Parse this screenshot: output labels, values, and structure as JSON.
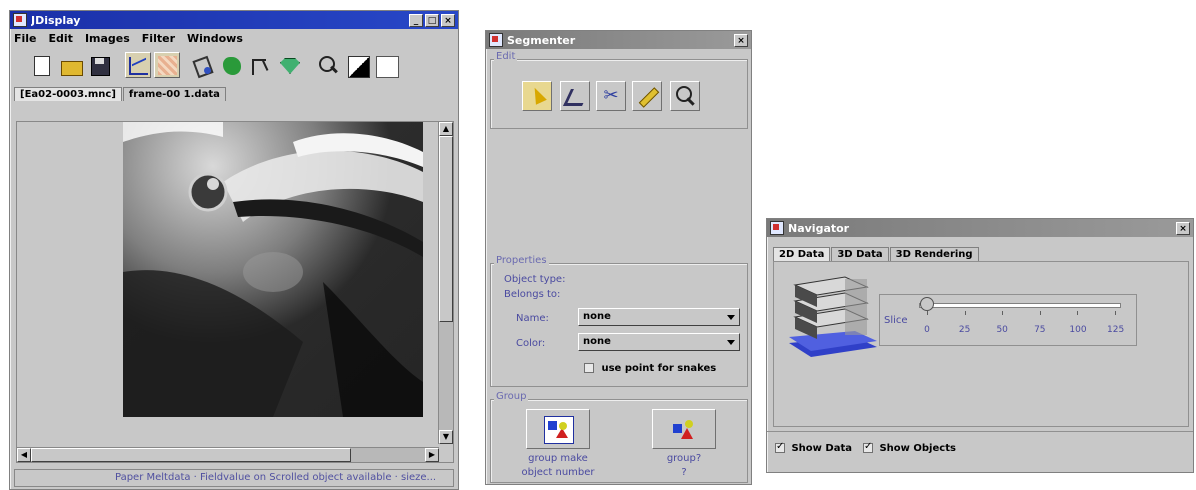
{
  "jdisplay": {
    "title": "JDisplay",
    "menu": [
      "File",
      "Edit",
      "Images",
      "Filter",
      "Windows"
    ],
    "tabs": [
      "[Ea02-0003.mnc]",
      "frame-00 1.data"
    ],
    "status": "Paper Meltdata   ·   Fieldvalue on Scrolled object available   ·   sieze..."
  },
  "segmenter": {
    "title": "Segmenter",
    "edit_legend": "Edit",
    "properties_legend": "Properties",
    "object_type_label": "Object type:",
    "belongs_to_label": "Belongs to:",
    "name_label": "Name:",
    "name_value": "none",
    "color_label": "Color:",
    "color_value": "none",
    "snake_label": "use point for snakes",
    "group_legend": "Group",
    "group_make_caption_1": "group make",
    "group_make_caption_2": "object number",
    "group_caption_1": "group?",
    "group_caption_2": "?"
  },
  "navigator": {
    "title": "Navigator",
    "tabs": [
      "2D Data",
      "3D Data",
      "3D Rendering"
    ],
    "slice_label": "Slice",
    "ticks": [
      "0",
      "25",
      "50",
      "75",
      "100",
      "125"
    ],
    "slider_value": 0,
    "show_data_label": "Show Data",
    "show_objects_label": "Show Objects"
  },
  "colors": {
    "title_active": "#1a2fa8",
    "title_inactive": "#808080",
    "panel": "#c8c8c8",
    "label_blue": "#4a4aa0"
  }
}
